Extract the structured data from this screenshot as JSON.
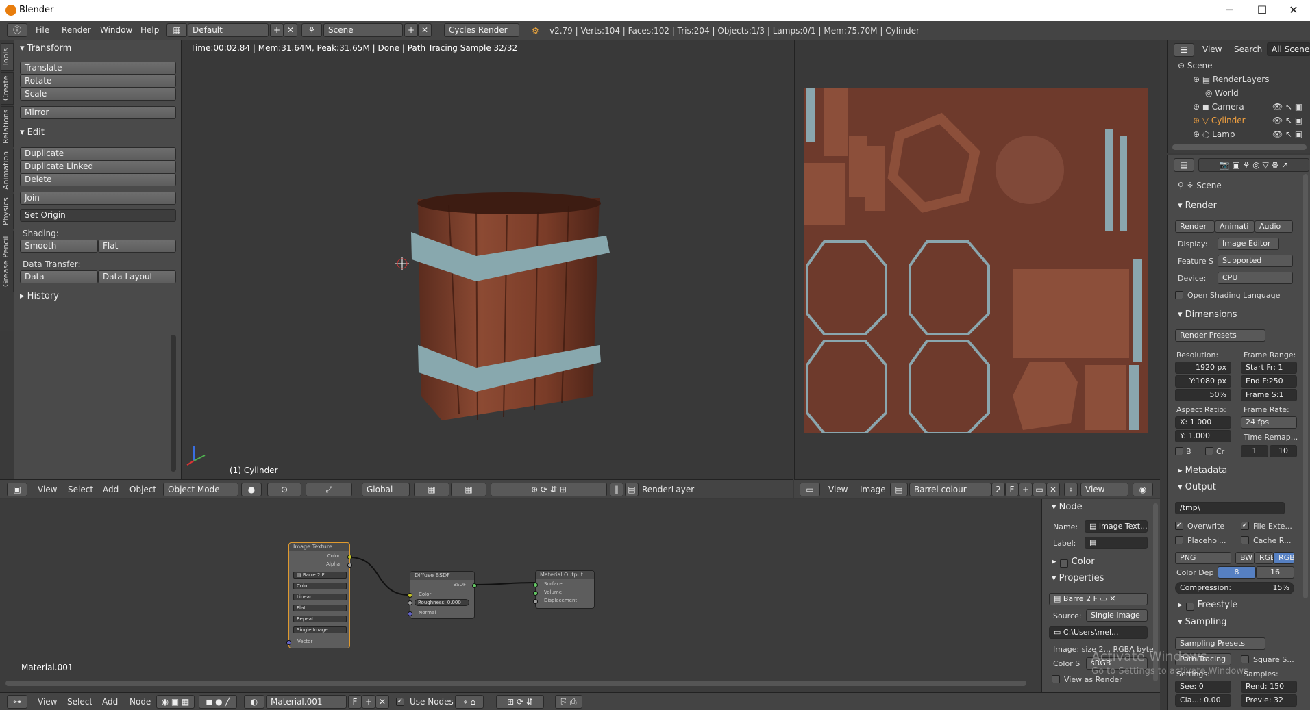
{
  "window": {
    "title": "Blender",
    "minimize": "─",
    "maximize": "☐",
    "close": "✕"
  },
  "menubar": {
    "menus": [
      "File",
      "Render",
      "Window",
      "Help"
    ],
    "layout": "Default",
    "scene": "Scene",
    "engine": "Cycles Render",
    "stats": "v2.79 | Verts:104 | Faces:102 | Tris:204 | Objects:1/3 | Lamps:0/1 | Mem:75.70M | Cylinder"
  },
  "tool_tabs": [
    "Tools",
    "Create",
    "Relations",
    "Animation",
    "Physics",
    "Grease Pencil"
  ],
  "tool_panel": {
    "transform": {
      "title": "Transform",
      "buttons": [
        "Translate",
        "Rotate",
        "Scale",
        "Mirror"
      ]
    },
    "edit": {
      "title": "Edit",
      "buttons": [
        "Duplicate",
        "Duplicate Linked",
        "Delete",
        "Join"
      ],
      "set_origin": "Set Origin"
    },
    "shading": {
      "label": "Shading:",
      "smooth": "Smooth",
      "flat": "Flat"
    },
    "data_transfer": {
      "label": "Data Transfer:",
      "data": "Data",
      "data_layout": "Data Layout"
    },
    "history": "History"
  },
  "viewport3d": {
    "info": "Time:00:02.84 | Mem:31.64M, Peak:31.65M | Done | Path Tracing Sample 32/32",
    "object_label": "(1) Cylinder",
    "header": {
      "menus": [
        "View",
        "Select",
        "Add",
        "Object"
      ],
      "mode": "Object Mode",
      "orientation": "Global",
      "render_layer": "RenderLayer"
    }
  },
  "image_editor": {
    "header": {
      "menus": [
        "View",
        "Image"
      ],
      "image": "Barrel colour",
      "users": "2",
      "fake": "F",
      "view": "View"
    }
  },
  "outliner": {
    "header": {
      "view": "View",
      "search": "Search",
      "filter": "All Scenes"
    },
    "items": [
      "Scene",
      "RenderLayers",
      "World",
      "Camera",
      "Cylinder",
      "Lamp"
    ]
  },
  "properties": {
    "context": "Scene",
    "render": {
      "title": "Render",
      "buttons": [
        "Render",
        "Animati",
        "Audio"
      ],
      "display_label": "Display:",
      "display": "Image Editor",
      "feature_label": "Feature S",
      "feature": "Supported",
      "device_label": "Device:",
      "device": "CPU",
      "osl": "Open Shading Language"
    },
    "dimensions": {
      "title": "Dimensions",
      "presets": "Render Presets",
      "resolution_label": "Resolution:",
      "res_x": "1920 px",
      "res_y": "Y:1080 px",
      "res_pct": "50%",
      "frame_range_label": "Frame Range:",
      "start": "Start Fr: 1",
      "end": "End F:250",
      "step": "Frame S:1",
      "aspect_label": "Aspect Ratio:",
      "aspect_x": "X:  1.000",
      "aspect_y": "Y:  1.000",
      "frame_rate_label": "Frame Rate:",
      "fps": "24 fps",
      "time_remap_label": "Time Remap...",
      "remap_old": "1",
      "remap_new": "10",
      "border": "B",
      "crop": "Cr"
    },
    "metadata": {
      "title": "Metadata"
    },
    "output": {
      "title": "Output",
      "path": "/tmp\\",
      "overwrite": "Overwrite",
      "file_ext": "File Exte...",
      "placeholders": "Placehol...",
      "cache": "Cache R...",
      "format": "PNG",
      "bw": "BW",
      "rgb": "RGB",
      "rgba": "RGB",
      "color_depth_label": "Color Dep",
      "depth8": "8",
      "depth16": "16",
      "compression": "Compression:",
      "compression_val": "15%"
    },
    "freestyle": {
      "title": "Freestyle"
    },
    "sampling": {
      "title": "Sampling",
      "presets": "Sampling Presets",
      "method": "Path Tracing",
      "square": "Square S...",
      "settings_label": "Settings:",
      "samples_label": "Samples:",
      "seed": "See: 0",
      "render": "Rend: 150",
      "clamp": "Cla...: 0.00",
      "preview": "Previe: 32"
    }
  },
  "node_editor": {
    "material_label": "Material.001",
    "nodes": {
      "image_texture": {
        "title": "Image Texture",
        "out_color": "Color",
        "out_alpha": "Alpha",
        "image": "Barre",
        "users": "2",
        "fake": "F",
        "options": [
          "Color",
          "Linear",
          "Flat",
          "Repeat",
          "Single Image"
        ],
        "in_vector": "Vector"
      },
      "diffuse": {
        "title": "Diffuse BSDF",
        "out": "BSDF",
        "in_color": "Color",
        "roughness": "Roughness:",
        "roughness_val": "0.000",
        "in_normal": "Normal"
      },
      "output": {
        "title": "Material Output",
        "surface": "Surface",
        "volume": "Volume",
        "displacement": "Displacement"
      }
    },
    "header": {
      "menus": [
        "View",
        "Select",
        "Add",
        "Node"
      ],
      "material": "Material.001",
      "fake": "F",
      "use_nodes": "Use Nodes"
    }
  },
  "node_props": {
    "node_title": "Node",
    "name_label": "Name:",
    "name": "Image Text...",
    "label_label": "Label:",
    "color_title": "Color",
    "properties_title": "Properties",
    "image": "Barre",
    "users": "2",
    "fake": "F",
    "source_label": "Source:",
    "source": "Single Image",
    "filepath": "C:\\Users\\mel...",
    "image_size": "Image: size 2... RGBA byte",
    "color_space_label": "Color S",
    "color_space": "sRGB",
    "view_as_render": "View as Render"
  },
  "watermark": {
    "line1": "Activate Windows",
    "line2": "Go to Settings to activate Windows."
  }
}
